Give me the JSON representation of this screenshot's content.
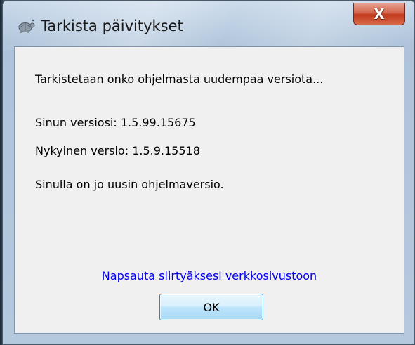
{
  "window": {
    "title": "Tarkista päivitykset",
    "close_label": "X"
  },
  "content": {
    "checking_text": "Tarkistetaan onko ohjelmasta uudempaa versiota...",
    "your_version": "Sinun versiosi: 1.5.99.15675",
    "current_version": "Nykyinen versio: 1.5.9.15518",
    "status_text": "Sinulla on jo uusin ohjelmaversio.",
    "website_link": "Napsauta siirtyäksesi verkkosivustoon"
  },
  "buttons": {
    "ok_label": "OK"
  },
  "colors": {
    "link": "#0000ee",
    "close_button": "#c23a1e",
    "client_background": "#f0f0f0"
  },
  "icons": {
    "app": "tortoise-icon",
    "close": "close-icon"
  }
}
